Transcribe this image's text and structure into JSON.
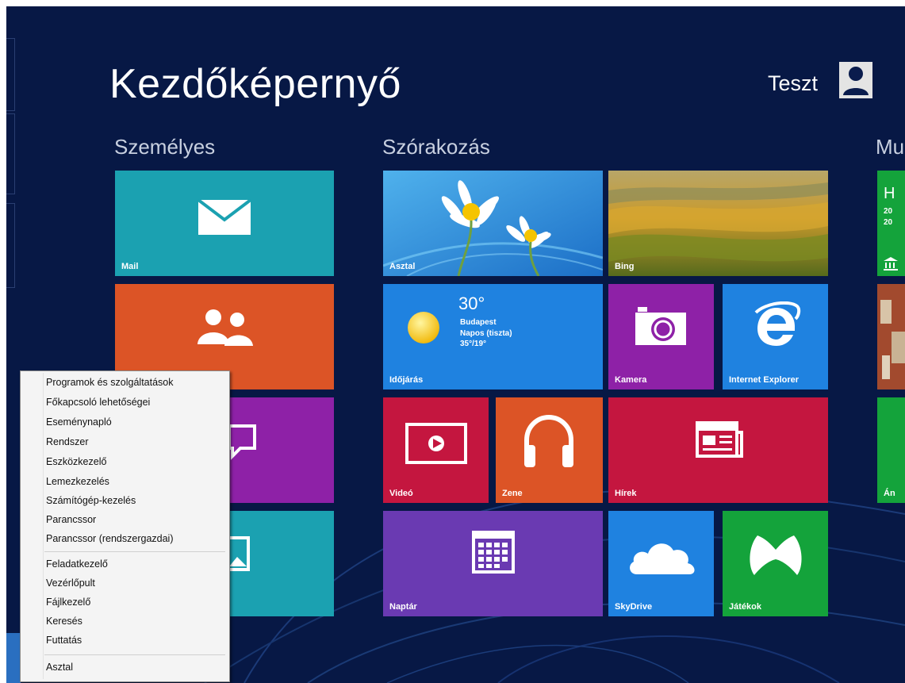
{
  "start": {
    "title": "Kezdőképernyő",
    "user": {
      "name": "Teszt"
    }
  },
  "groups": {
    "personal": "Személyes",
    "entertainment": "Szórakozás",
    "partial": "Mu"
  },
  "tiles": {
    "mail": "Mail",
    "desktop": "Asztal",
    "bing": "Bing",
    "weather": {
      "label": "Időjárás",
      "temp": "30°",
      "city": "Budapest",
      "condition": "Napos (tiszta)",
      "range": "35°/19°"
    },
    "camera": "Kamera",
    "ie": "Internet Explorer",
    "video": "Videó",
    "music": "Zene",
    "news": "Hírek",
    "calendar": "Naptár",
    "skydrive": "SkyDrive",
    "games": "Játékok",
    "partial_green": {
      "line1": "H",
      "line2": "20",
      "line3": "20",
      "bottom": "Án"
    }
  },
  "context_menu": {
    "items": [
      "Programok és szolgáltatások",
      "Főkapcsoló lehetőségei",
      "Eseménynapló",
      "Rendszer",
      "Eszközkezelő",
      "Lemezkezelés",
      "Számítógép-kezelés",
      "Parancssor",
      "Parancssor (rendszergazdai)",
      "Feladatkezelő",
      "Vezérlőpult",
      "Fájlkezelő",
      "Keresés",
      "Futtatás",
      "Asztal"
    ]
  },
  "colors": {
    "background": "#071845",
    "teal": "#1ba1b1",
    "orange": "#dc5426",
    "purple": "#8e21a7",
    "red": "#c4163f",
    "blue": "#1f82e0",
    "violet": "#6a3ab2",
    "green": "#14a33b"
  }
}
